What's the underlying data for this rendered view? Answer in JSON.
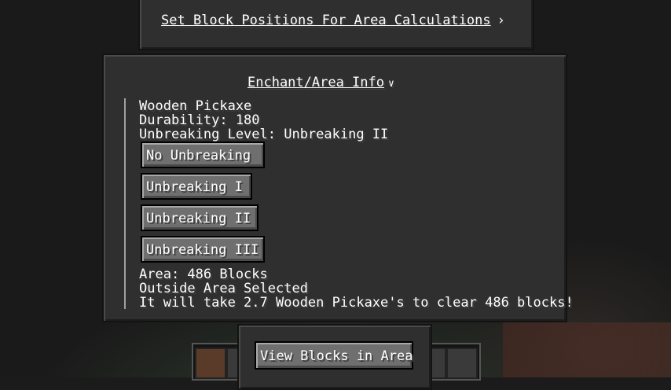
{
  "header": {
    "set_positions_link": "Set Block Positions For Area Calculations",
    "chevron_right": "›"
  },
  "enchant_section": {
    "title": "Enchant/Area Info",
    "chevron_down": "∨",
    "item_name": "Wooden Pickaxe",
    "durability": "Durability: 180",
    "unbreaking_level": "Unbreaking Level: Unbreaking II",
    "buttons": [
      "No Unbreaking",
      "Unbreaking I",
      "Unbreaking II",
      "Unbreaking III"
    ],
    "area": "Area: 486 Blocks",
    "selection_status": "Outside Area Selected",
    "clear_estimate": "It will take 2.7 Wooden Pickaxe's to clear 486 blocks!"
  },
  "footer": {
    "view_blocks_button": "View Blocks in Area"
  }
}
